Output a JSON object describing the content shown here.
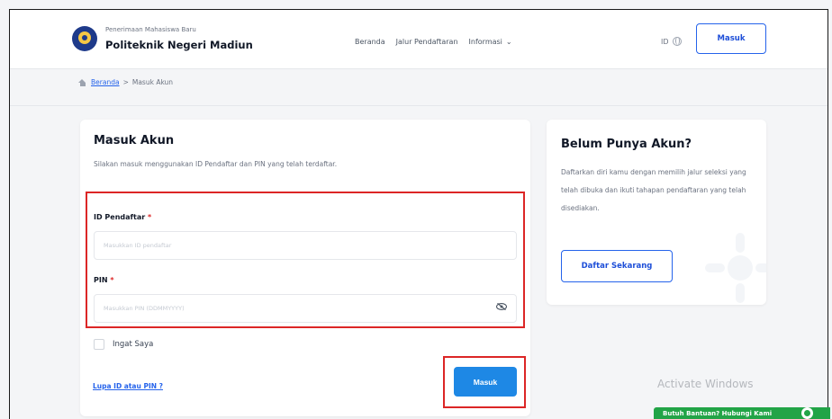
{
  "header": {
    "brand_small": "Penerimaan Mahasiswa Baru",
    "brand_title": "Politeknik Negeri Madiun",
    "nav": {
      "home": "Beranda",
      "jalur": "Jalur Pendaftaran",
      "info": "Informasi"
    },
    "lang": "ID",
    "login_label": "Masuk"
  },
  "breadcrumb": {
    "home": "Beranda",
    "separator": ">",
    "current": "Masuk Akun"
  },
  "login": {
    "title": "Masuk Akun",
    "subtitle": "Silakan masuk menggunakan ID Pendaftar dan PIN yang telah terdaftar.",
    "id_label": "ID Pendaftar",
    "id_placeholder": "Masukkan ID pendaftar",
    "pin_label": "PIN",
    "pin_placeholder": "Masukkan PIN (DDMMYYYY)",
    "required_mark": "*",
    "remember_label": "Ingat Saya",
    "forgot_label": "Lupa ID atau PIN ?",
    "submit_label": "Masuk"
  },
  "register": {
    "title": "Belum Punya Akun?",
    "text": "Daftarkan diri kamu dengan memilih jalur seleksi yang telah dibuka dan ikuti tahapan pendaftaran yang telah disediakan.",
    "button_label": "Daftar Sekarang"
  },
  "overlay": {
    "watermark": "Activate Windows",
    "help_text": "Butuh Bantuan? Hubungi Kami"
  },
  "colors": {
    "accent": "#2563eb",
    "primary_button": "#1e88e5",
    "highlight": "#dc2626",
    "help_green": "#22a447"
  }
}
